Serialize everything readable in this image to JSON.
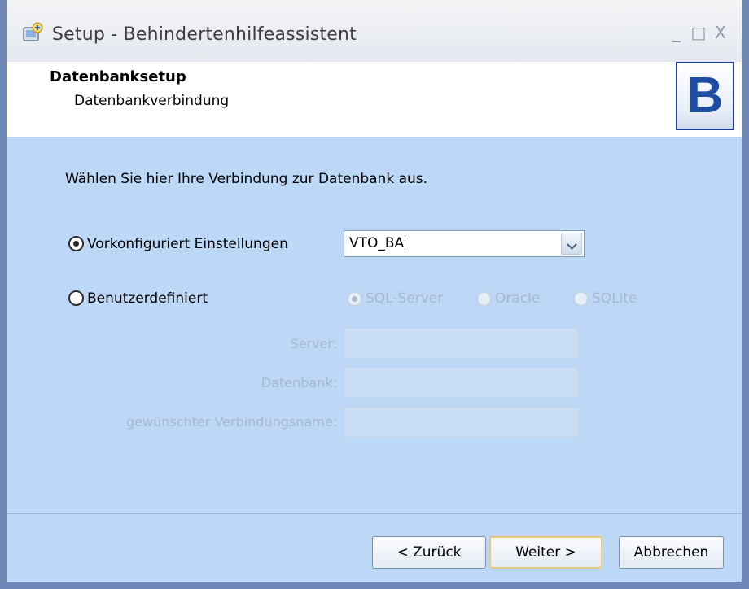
{
  "window": {
    "title": "Setup - Behindertenhilfeassistent",
    "controls": {
      "minimize": "_",
      "maximize": "□",
      "close": "X"
    }
  },
  "header": {
    "title": "Datenbanksetup",
    "subtitle": "Datenbankverbindung",
    "logo_letter": "B"
  },
  "content": {
    "intro": "Wählen Sie hier Ihre Verbindung zur Datenbank aus.",
    "option_preconfigured": {
      "label": "Vorkonfiguriert Einstellungen",
      "selected": true
    },
    "connection_combo": {
      "value": "VTO_BA"
    },
    "option_custom": {
      "label": "Benutzerdefiniert",
      "selected": false
    },
    "db_types": [
      {
        "label": "SQL-Server",
        "selected": true
      },
      {
        "label": "Oracle",
        "selected": false
      },
      {
        "label": "SQLite",
        "selected": false
      }
    ],
    "fields": {
      "server_label": "Server:",
      "database_label": "Datenbank:",
      "connection_name_label": "gewünschter Verbindungsname:"
    }
  },
  "footer": {
    "back": "< Zurück",
    "next": "Weiter >",
    "cancel": "Abbrechen"
  },
  "colors": {
    "panel_background": "#bcd8f6",
    "frame": "#6d88b6",
    "logo": "#1e4ea3",
    "disabled_text": "#a8b8cc"
  }
}
